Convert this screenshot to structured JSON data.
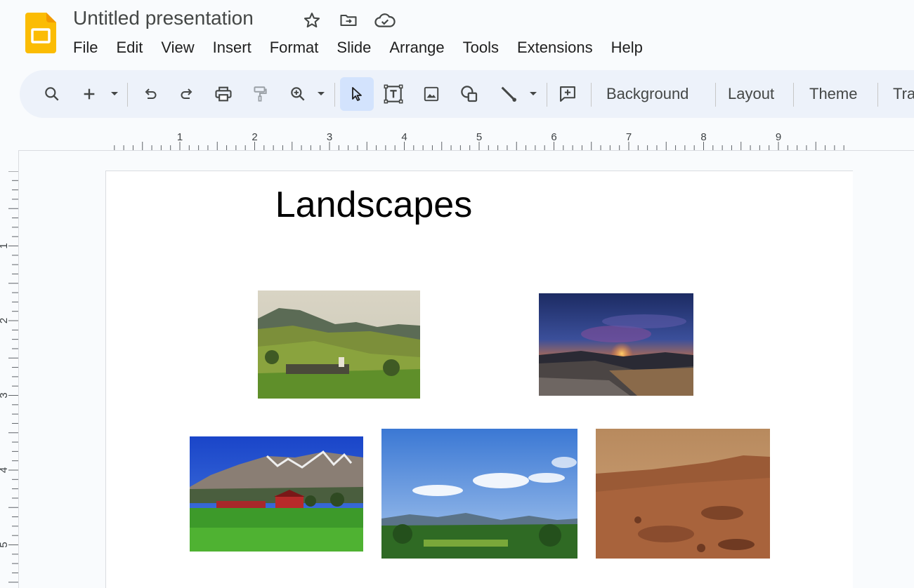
{
  "app": {
    "document_title": "Untitled presentation",
    "logo_icon": "slides-logo-icon",
    "brand_color": "#fbbc04"
  },
  "title_icons": [
    "star-icon",
    "move-to-folder-icon",
    "cloud-saved-icon"
  ],
  "menu": [
    "File",
    "Edit",
    "View",
    "Insert",
    "Format",
    "Slide",
    "Arrange",
    "Tools",
    "Extensions",
    "Help"
  ],
  "toolbar": {
    "icons": [
      "search-icon",
      "new-slide-icon",
      "dropdown-icon",
      "undo-icon",
      "redo-icon",
      "print-icon",
      "paint-format-icon",
      "zoom-icon",
      "dropdown-icon",
      "select-icon",
      "text-box-icon",
      "image-icon",
      "shape-icon",
      "line-icon",
      "dropdown-icon",
      "comment-icon"
    ],
    "background_label": "Background",
    "layout_label": "Layout",
    "theme_label": "Theme",
    "transition_label": "Tra",
    "active_color": "#d3e3fd"
  },
  "ruler": {
    "horizontal_labels": [
      "1",
      "2",
      "3",
      "4",
      "5",
      "6",
      "7",
      "8",
      "9"
    ],
    "vertical_labels": [
      "1",
      "2",
      "3",
      "4",
      "5"
    ]
  },
  "slide": {
    "title": "Landscapes",
    "images": [
      {
        "name": "alpine-village-image",
        "description_icon": "mountain-valley"
      },
      {
        "name": "sunset-image",
        "description_icon": "sunset"
      },
      {
        "name": "farm-mountain-image",
        "description_icon": "farm"
      },
      {
        "name": "forest-sky-image",
        "description_icon": "forest"
      },
      {
        "name": "mars-desert-image",
        "description_icon": "desert"
      }
    ]
  }
}
